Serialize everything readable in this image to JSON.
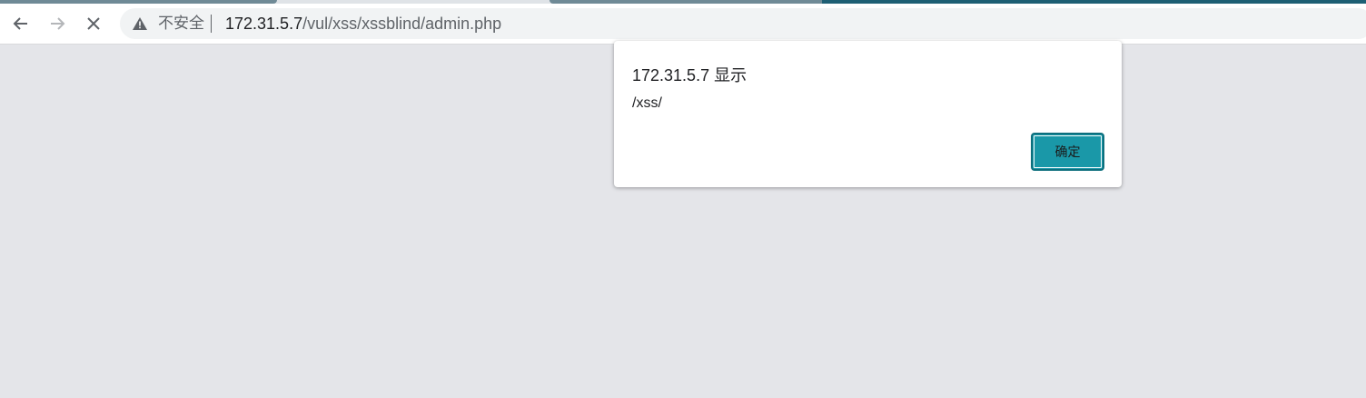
{
  "browser": {
    "security_label": "不安全",
    "url_host": "172.31.5.7",
    "url_path": "/vul/xss/xssblind/admin.php"
  },
  "icons": {
    "back": "back-arrow-icon",
    "forward": "forward-arrow-icon",
    "stop": "close-icon",
    "warning": "warning-triangle-icon"
  },
  "dialog": {
    "title": "172.31.5.7 显示",
    "message": "/xss/",
    "ok_label": "确定"
  },
  "colors": {
    "page_background": "#e4e5e9",
    "ok_button": "#1a98a8",
    "active_tab_strip": "#1e5f74"
  }
}
